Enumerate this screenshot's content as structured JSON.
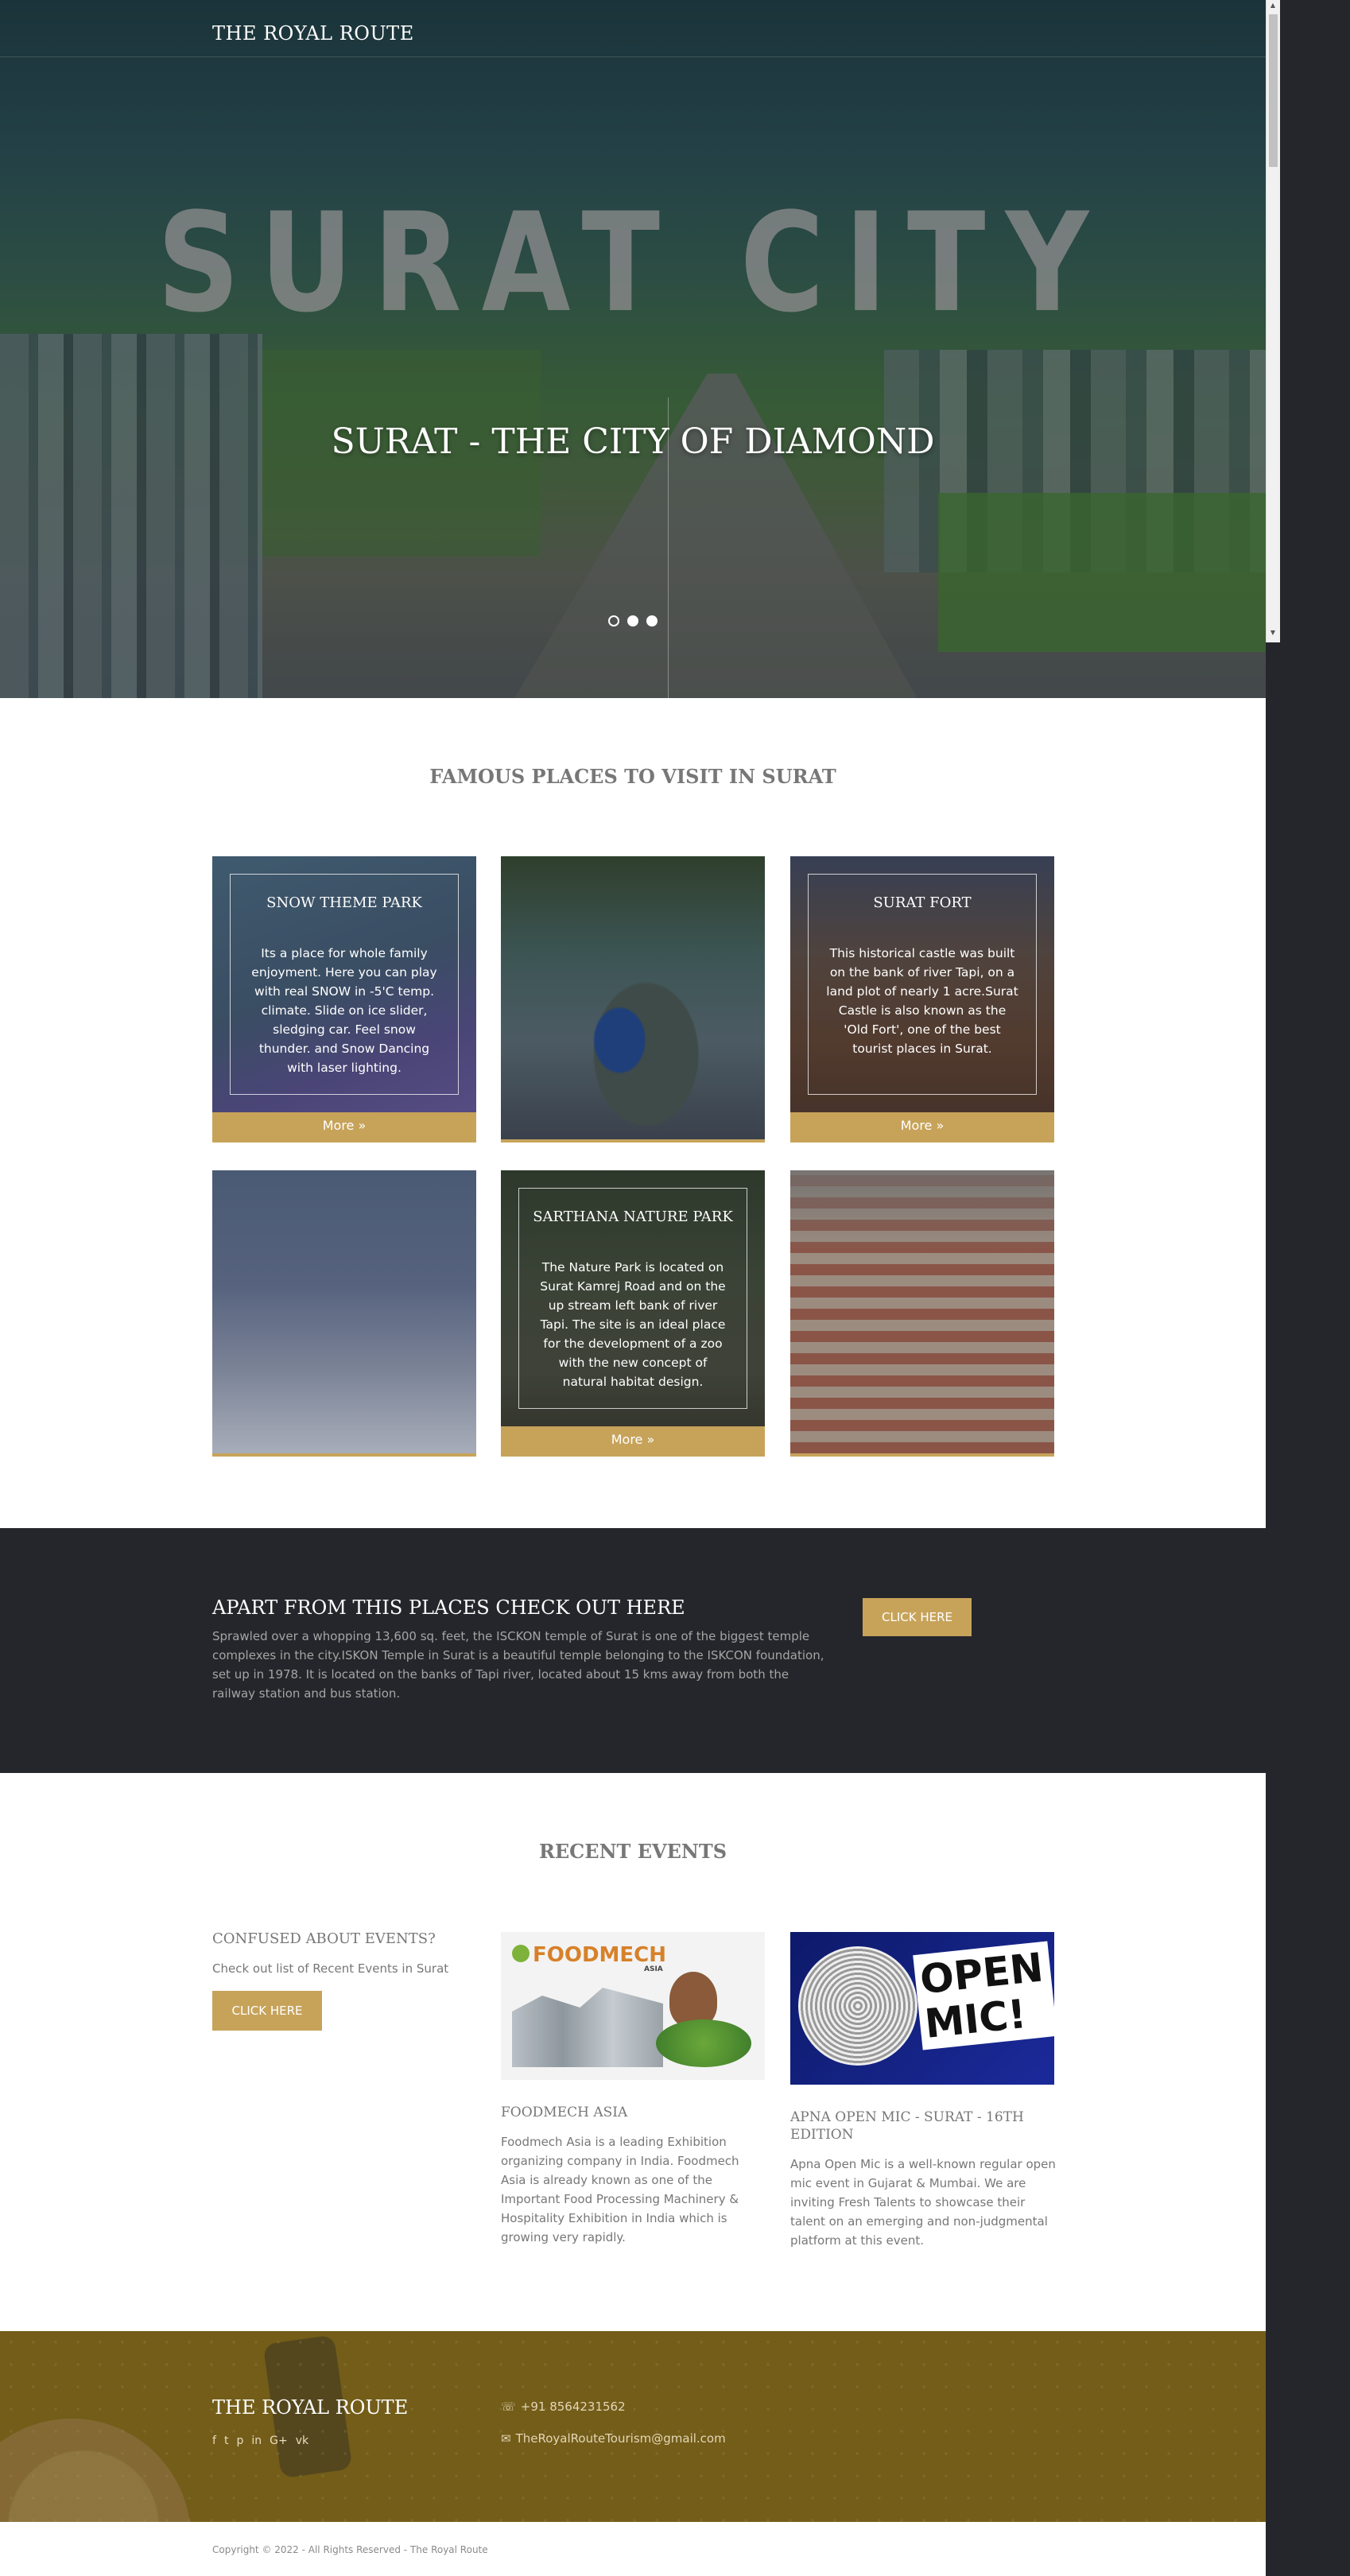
{
  "header": {
    "brand": "THE ROYAL ROUTE"
  },
  "hero": {
    "big_title": "SURAT CITY",
    "subtitle": "SURAT - THE CITY OF DIAMOND",
    "slides": 3,
    "active_slide": 1
  },
  "places": {
    "title": "FAMOUS PLACES TO VISIT IN SURAT",
    "more_label": "More »",
    "cards": [
      {
        "title": "SNOW THEME PARK",
        "text": "Its a place for whole family enjoyment. Here you can play with real SNOW in -5'C temp. climate. Slide on ice slider, sledging car. Feel snow thunder. and Snow Dancing with laser lighting."
      },
      {
        "title": "",
        "text": ""
      },
      {
        "title": "SURAT FORT",
        "text": "This historical castle was built on the bank of river Tapi, on a land plot of nearly 1 acre.Surat Castle is also known as the 'Old Fort', one of the best tourist places in Surat."
      },
      {
        "title": "",
        "text": ""
      },
      {
        "title": "SARTHANA NATURE PARK",
        "text": "The Nature Park is located on Surat Kamrej Road and on the up stream left bank of river Tapi. The site is an ideal place for the development of a zoo with the new concept of natural habitat design."
      },
      {
        "title": "",
        "text": ""
      }
    ]
  },
  "promo": {
    "title": "APART FROM THIS PLACES CHECK OUT HERE",
    "text": "Sprawled over a whopping 13,600 sq. feet, the ISCKON temple of Surat is one of the biggest temple complexes in the city.ISKON Temple in Surat is a beautiful temple belonging to the ISKCON foundation, set up in 1978. It is located on the banks of Tapi river, located about 15 kms away from both the railway station and bus station.",
    "button": "CLICK HERE"
  },
  "events": {
    "title": "RECENT EVENTS",
    "side_title": "CONFUSED ABOUT EVENTS?",
    "side_text": "Check out list of Recent Events in Surat",
    "side_button": "CLICK HERE",
    "items": [
      {
        "title": "FOODMECH ASIA",
        "logo_text": "FOODMECH",
        "logo_sub": "ASIA",
        "text": "Foodmech Asia is a leading Exhibition organizing company in India. Foodmech Asia is already known as one of the Important Food Processing Machinery & Hospitality Exhibition in India which is growing very rapidly."
      },
      {
        "title": "APNA OPEN MIC - SURAT - 16TH EDITION",
        "logo_text": "OPEN MIC!",
        "text": "Apna Open Mic is a well-known regular open mic event in Gujarat & Mumbai. We are inviting Fresh Talents to showcase their talent on an emerging and non-judgmental platform at this event."
      }
    ]
  },
  "footer": {
    "brand": "THE ROYAL ROUTE",
    "social_icons": [
      "facebook-icon",
      "twitter-icon",
      "pinterest-icon",
      "linkedin-icon",
      "google-plus-icon",
      "vk-icon"
    ],
    "social_glyphs": [
      "f",
      "t",
      "p",
      "in",
      "G+",
      "vk"
    ],
    "phone": "+91 8564231562",
    "email": "TheRoyalRouteTourism@gmail.com",
    "copyright": "Copyright © 2022 - All Rights Reserved - The Royal Route"
  },
  "colors": {
    "accent": "#c7a35a",
    "dark": "#25262b",
    "footer": "#7a6420"
  }
}
